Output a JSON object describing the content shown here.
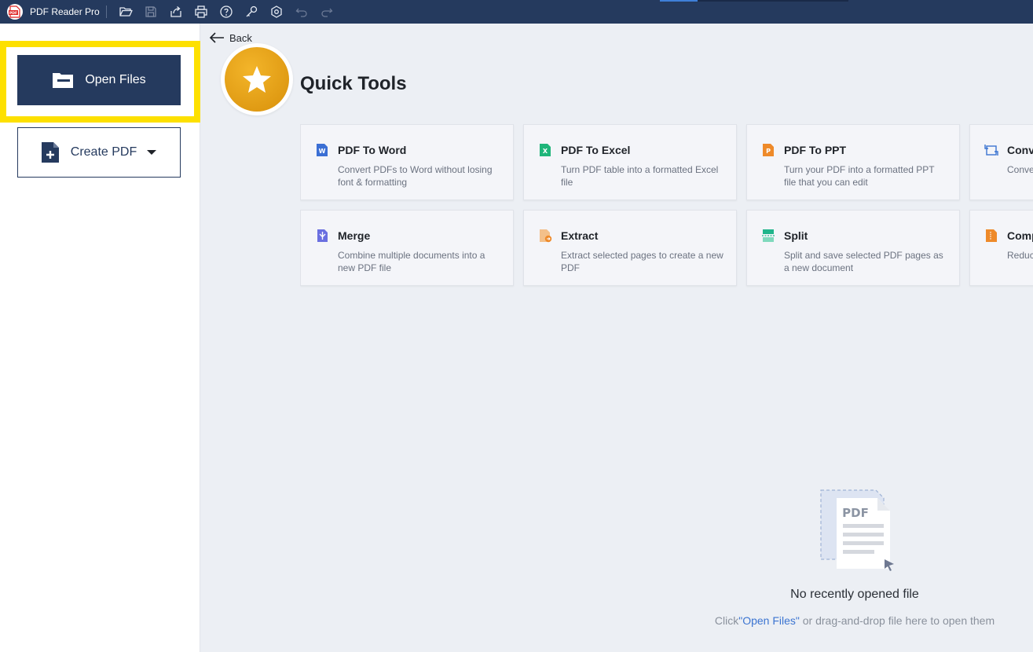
{
  "app": {
    "name": "PDF Reader Pro",
    "icons": [
      "open-folder-icon",
      "save-icon",
      "share-icon",
      "print-icon",
      "help-icon",
      "key-icon",
      "settings-icon",
      "undo-icon",
      "redo-icon"
    ]
  },
  "sidebar": {
    "open_files_label": "Open Files",
    "create_pdf_label": "Create PDF"
  },
  "main": {
    "back_label": "Back",
    "title": "Quick Tools",
    "tools": [
      {
        "title": "PDF To Word",
        "desc": "Convert PDFs to Word without losing font & formatting",
        "icon": "word-icon",
        "color": "#3b6fd4"
      },
      {
        "title": "PDF To Excel",
        "desc": "Turn PDF table into a formatted Excel file",
        "icon": "excel-icon",
        "color": "#1fb57a"
      },
      {
        "title": "PDF To PPT",
        "desc": "Turn your PDF into a formatted PPT file that you can edit",
        "icon": "ppt-icon",
        "color": "#ee8a2a"
      },
      {
        "title": "Conv",
        "desc": "Conve JPEG/P",
        "icon": "convert-image-icon",
        "color": "#3b74d1"
      },
      {
        "title": "Merge",
        "desc": "Combine multiple documents into a new PDF file",
        "icon": "merge-icon",
        "color": "#6a6fe0"
      },
      {
        "title": "Extract",
        "desc": "Extract selected pages to create a new PDF",
        "icon": "extract-icon",
        "color": "#f0a24a"
      },
      {
        "title": "Split",
        "desc": "Split and save selected PDF pages as a new document",
        "icon": "split-icon",
        "color": "#20b58b"
      },
      {
        "title": "Comp",
        "desc": "Reduc easily",
        "icon": "compress-icon",
        "color": "#ee8a2a"
      }
    ]
  },
  "empty_state": {
    "illustration_text": "PDF",
    "title": "No recently opened file",
    "hint_prefix": "Click",
    "hint_link": "\"Open Files\"",
    "hint_suffix": " or drag-and-drop file here to open them"
  }
}
